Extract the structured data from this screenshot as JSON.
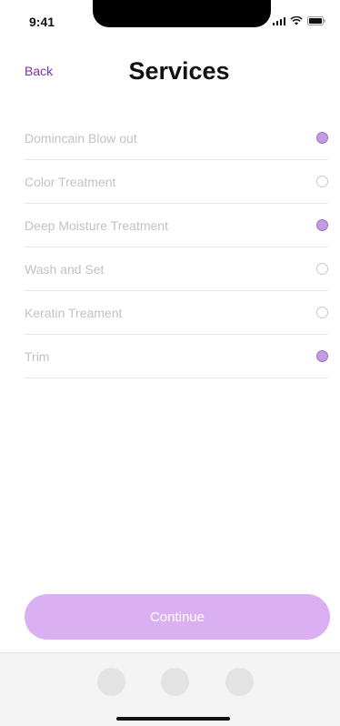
{
  "status_bar": {
    "time": "9:41"
  },
  "header": {
    "back_label": "Back",
    "title": "Services"
  },
  "services": [
    {
      "label": "Domincain Blow out",
      "selected": true
    },
    {
      "label": "Color Treatment",
      "selected": false
    },
    {
      "label": "Deep Moisture Treatment",
      "selected": true
    },
    {
      "label": "Wash and Set",
      "selected": false
    },
    {
      "label": "Keratin Treament",
      "selected": false
    },
    {
      "label": "Trim",
      "selected": true
    }
  ],
  "continue_label": "Continue",
  "colors": {
    "accent": "#7b2fa8",
    "radio_selected": "#c59ae3",
    "button": "#dbb0f3"
  }
}
